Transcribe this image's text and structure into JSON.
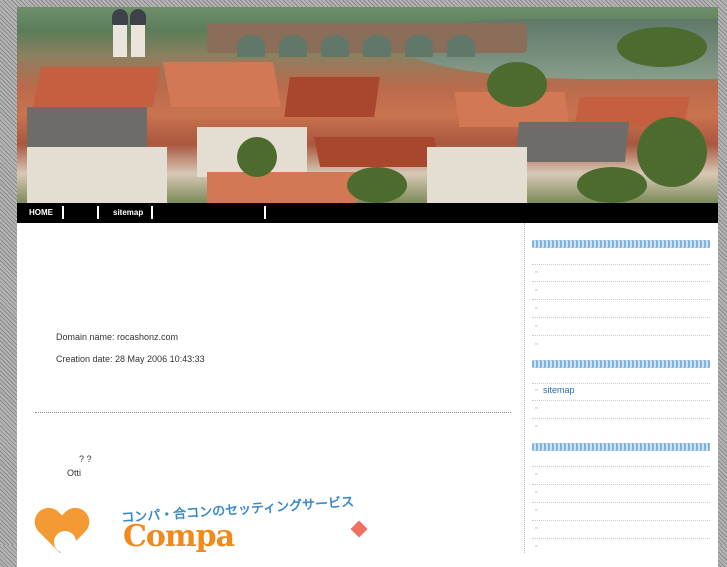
{
  "nav": {
    "home": "HOME",
    "sitemap": "sitemap"
  },
  "main": {
    "domain_line": "Domain name: rocashonz.com",
    "creation_line": "Creation date: 28 May 2006 10:43:33",
    "question_marks": "?     ?",
    "otti": "Otti"
  },
  "banner": {
    "tagline": "コンパ・合コンのセッティングサービス",
    "logo": "Compa"
  },
  "sidebar": {
    "link_sitemap": "sitemap"
  }
}
